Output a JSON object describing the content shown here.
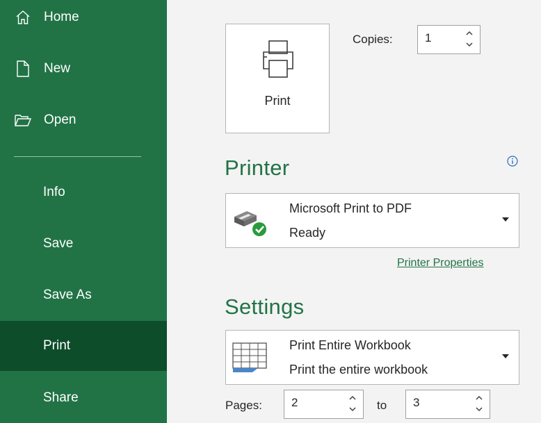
{
  "sidebar": {
    "items": [
      {
        "label": "Home",
        "icon": "home-icon"
      },
      {
        "label": "New",
        "icon": "new-document-icon"
      },
      {
        "label": "Open",
        "icon": "folder-open-icon"
      },
      {
        "label": "Info"
      },
      {
        "label": "Save"
      },
      {
        "label": "Save As"
      },
      {
        "label": "Print",
        "active": true
      },
      {
        "label": "Share"
      }
    ]
  },
  "print_panel": {
    "print_button_label": "Print",
    "copies_label": "Copies:",
    "copies_value": "1"
  },
  "printer": {
    "title": "Printer",
    "name": "Microsoft Print to PDF",
    "status": "Ready",
    "properties_link": "Printer Properties"
  },
  "settings": {
    "title": "Settings",
    "scope_title": "Print Entire Workbook",
    "scope_desc": "Print the entire workbook",
    "pages_label": "Pages:",
    "pages_from": "2",
    "to_label": "to",
    "pages_to": "3"
  },
  "colors": {
    "sidebar": "#217346",
    "sidebar_active": "#0e4d2a",
    "accent": "#217346",
    "background": "#f3f3f3"
  }
}
